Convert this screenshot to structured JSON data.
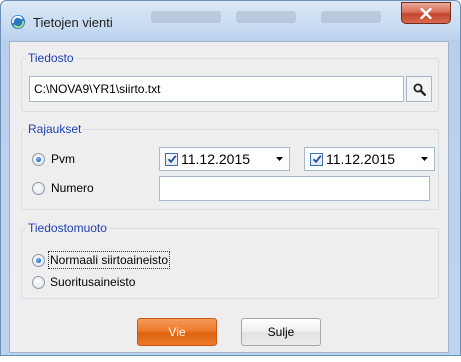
{
  "window": {
    "title": "Tietojen vienti",
    "close_label": "X"
  },
  "file_group": {
    "legend": "Tiedosto",
    "path_value": "C:\\NOVA9\\YR1\\siirto.txt",
    "browse_icon": "search-icon"
  },
  "filter_group": {
    "legend": "Rajaukset",
    "date_option": {
      "label": "Pvm",
      "selected": true
    },
    "number_option": {
      "label": "Numero",
      "selected": false
    },
    "date_from": {
      "value": "11.12.2015",
      "checked": true
    },
    "date_to": {
      "value": "11.12.2015",
      "checked": true
    },
    "number_value": ""
  },
  "format_group": {
    "legend": "Tiedostomuoto",
    "options": [
      {
        "label": "Normaali siirtoaineisto",
        "selected": true
      },
      {
        "label": "Suoritusaineisto",
        "selected": false
      }
    ]
  },
  "buttons": {
    "export_label": "Vie",
    "close_label": "Sulje"
  },
  "colors": {
    "accent_button": "#ee7a2e",
    "legend_text": "#1e3fb5",
    "close_button": "#c4462d"
  }
}
